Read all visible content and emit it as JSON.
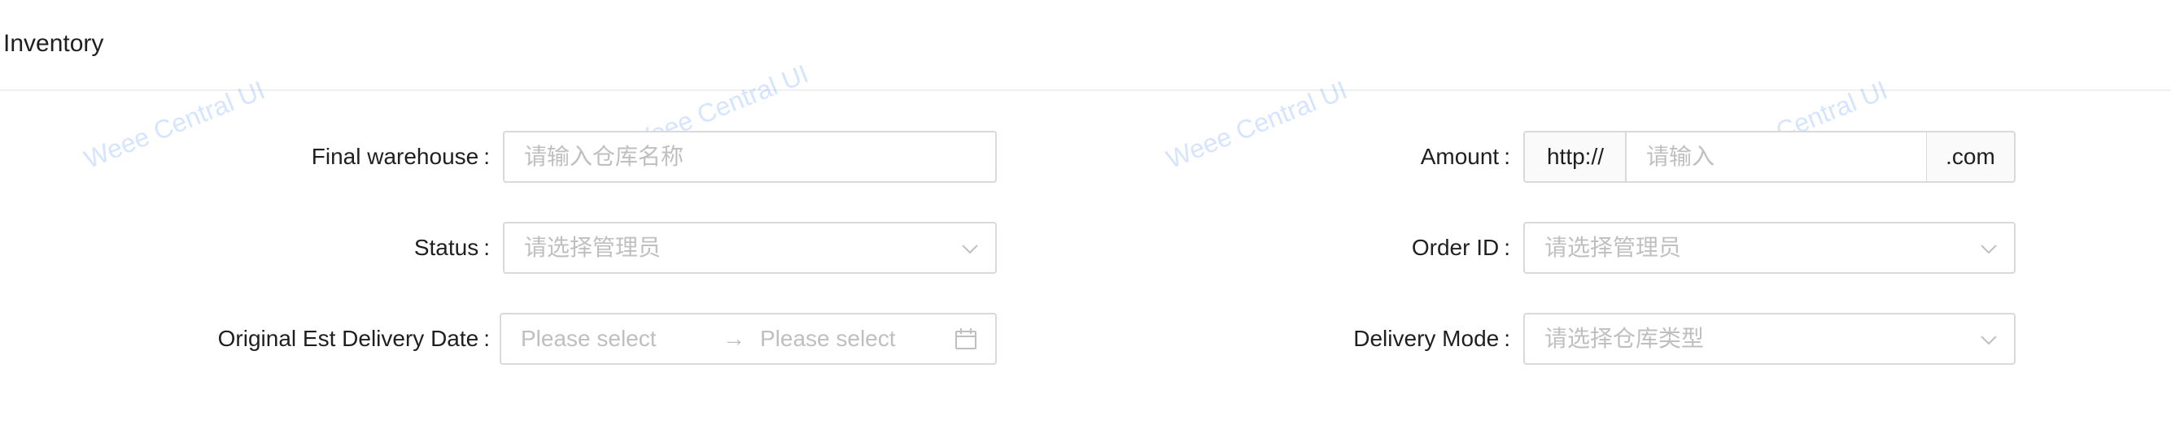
{
  "header": {
    "title": "Inventory"
  },
  "form": {
    "final_warehouse": {
      "label": "Final warehouse",
      "placeholder": "请输入仓库名称"
    },
    "amount": {
      "label": "Amount",
      "prefix": "http://",
      "placeholder": "请输入",
      "suffix": ".com"
    },
    "status": {
      "label": "Status",
      "placeholder": "请选择管理员"
    },
    "order_id": {
      "label": "Order ID",
      "placeholder": "请选择管理员"
    },
    "original_est_delivery_date": {
      "label": "Original Est Delivery Date",
      "start_placeholder": "Please select",
      "separator": "→",
      "end_placeholder": "Please select"
    },
    "delivery_mode": {
      "label": "Delivery Mode",
      "placeholder": "请选择仓库类型"
    },
    "colon": ":"
  },
  "watermark": {
    "text": "Weee Central UI"
  },
  "icons": {
    "select": "chevron-down-icon",
    "date": "calendar-icon"
  },
  "colors": {
    "border": "#d9d9d9",
    "placeholder": "#bfbfbf",
    "addon_bg": "#fafafa",
    "watermark": "#4084ff"
  }
}
